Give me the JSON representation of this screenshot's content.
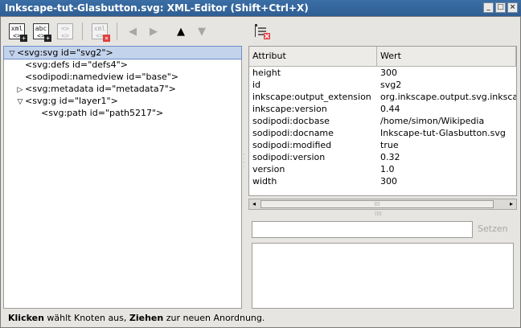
{
  "window": {
    "title": "Inkscape-tut-Glasbutton.svg: XML-Editor (Shift+Ctrl+X)",
    "btn_minimize": "_",
    "btn_maximize": "□",
    "btn_close": "×"
  },
  "toolbar": {
    "new_element_label": "xml",
    "new_text_label": "abc",
    "delete_label": "xml",
    "icon_names": [
      "new-element-node-icon",
      "new-text-node-icon",
      "duplicate-node-icon",
      "delete-node-icon",
      "unindent-icon",
      "indent-icon",
      "raise-node-icon",
      "lower-node-icon"
    ]
  },
  "tree": {
    "nodes": [
      {
        "label": "<svg:svg id=\"svg2\">",
        "expander": "▽",
        "level": 0,
        "selected": true
      },
      {
        "label": "<svg:defs id=\"defs4\">",
        "expander": "",
        "level": 1,
        "selected": false
      },
      {
        "label": "<sodipodi:namedview id=\"base\">",
        "expander": "",
        "level": 1,
        "selected": false
      },
      {
        "label": "<svg:metadata id=\"metadata7\">",
        "expander": "▷",
        "level": 1,
        "selected": false
      },
      {
        "label": "<svg:g id=\"layer1\">",
        "expander": "▽",
        "level": 1,
        "selected": false
      },
      {
        "label": "<svg:path id=\"path5217\">",
        "expander": "",
        "level": 2,
        "selected": false
      }
    ]
  },
  "attributes": {
    "header_name": "Attribut",
    "header_value": "Wert",
    "rows": [
      {
        "name": "height",
        "value": "300"
      },
      {
        "name": "id",
        "value": "svg2"
      },
      {
        "name": "inkscape:output_extension",
        "value": "org.inkscape.output.svg.inkscape"
      },
      {
        "name": "inkscape:version",
        "value": "0.44"
      },
      {
        "name": "sodipodi:docbase",
        "value": "/home/simon/Wikipedia"
      },
      {
        "name": "sodipodi:docname",
        "value": "Inkscape-tut-Glasbutton.svg"
      },
      {
        "name": "sodipodi:modified",
        "value": "true"
      },
      {
        "name": "sodipodi:version",
        "value": "0.32"
      },
      {
        "name": "version",
        "value": "1.0"
      },
      {
        "name": "width",
        "value": "300"
      }
    ]
  },
  "editor": {
    "attr_name_value": "",
    "set_button": "Setzen",
    "attr_value_text": ""
  },
  "status": {
    "part1_bold": "Klicken",
    "part2": " wählt Knoten aus, ",
    "part3_bold": "Ziehen",
    "part4": " zur neuen Anordnung."
  },
  "colors": {
    "titlebar": "#3a6ea5",
    "selection": "#c3d3ec",
    "background": "#e7e5e2"
  }
}
